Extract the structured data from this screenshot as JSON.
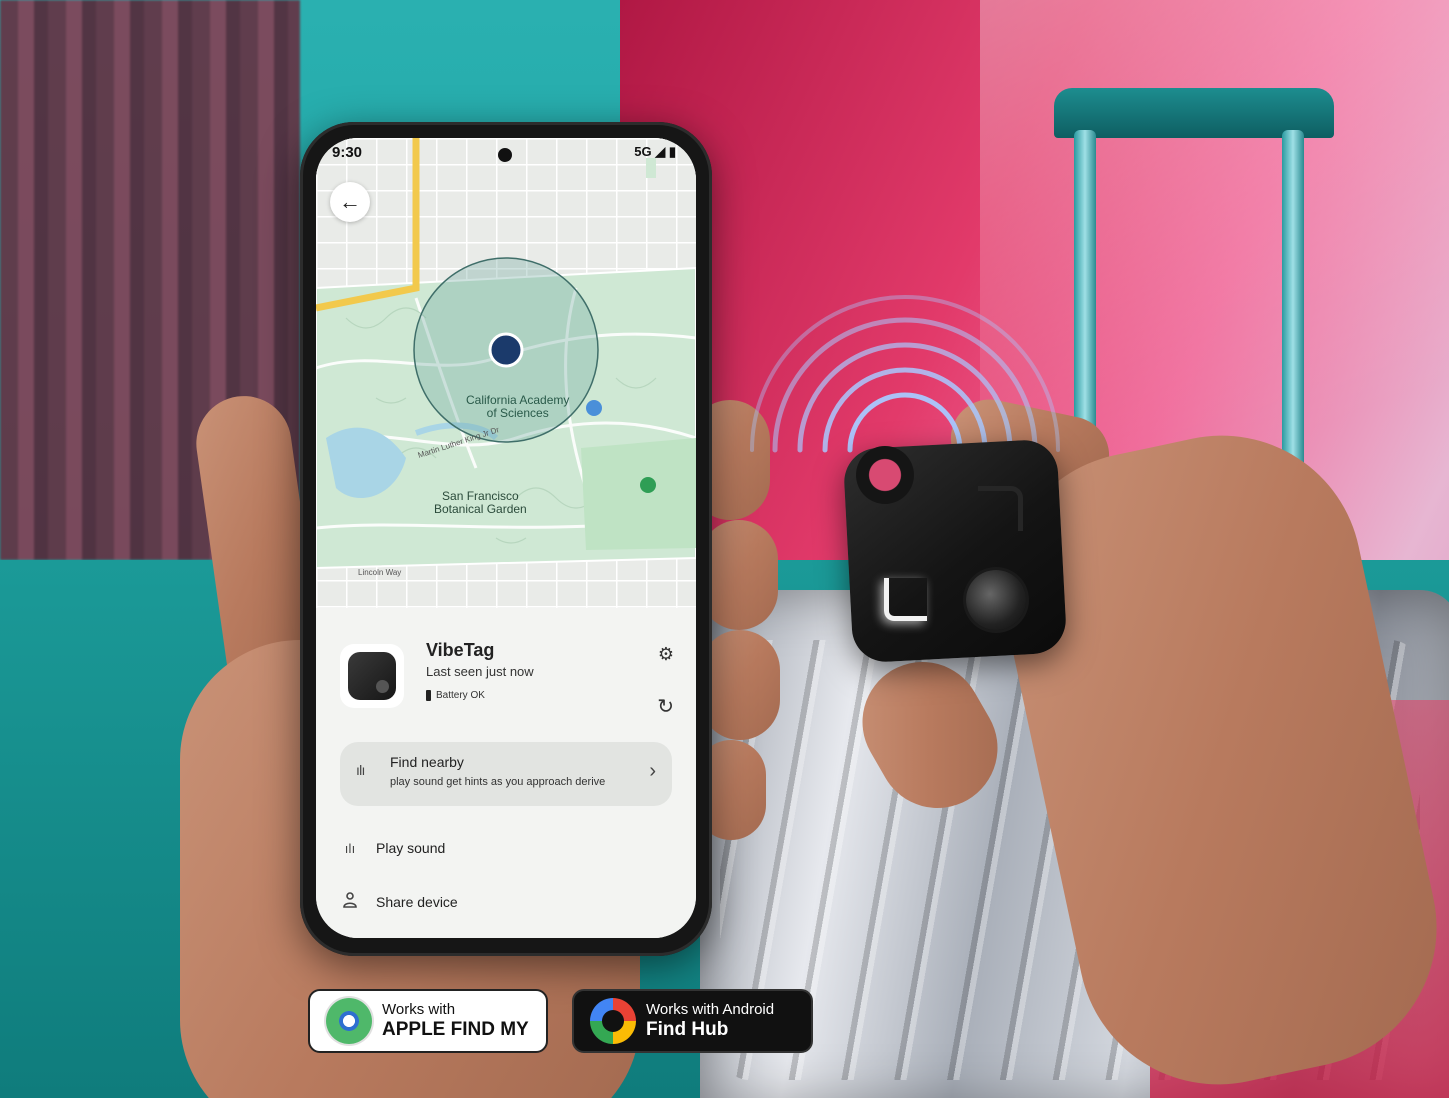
{
  "phone": {
    "status": {
      "time": "9:30",
      "network": "5G"
    },
    "map": {
      "labels": {
        "academy_line1": "California Academy",
        "academy_line2": "of Sciences",
        "garden_line1": "San Francisco",
        "garden_line2": "Botanical Garden",
        "street": "Martin Luther King Jr Dr",
        "way": "Lincoln Way"
      }
    },
    "device": {
      "name": "VibeTag",
      "last_seen": "Last seen just now",
      "battery": "Battery OK"
    },
    "find_nearby": {
      "title": "Find nearby",
      "subtitle": "play sound get hints as you approach derive"
    },
    "actions": [
      {
        "label": "Play sound",
        "icon": "sound-wave-icon"
      },
      {
        "label": "Share device",
        "icon": "person-icon"
      }
    ]
  },
  "badges": {
    "apple": {
      "small": "Works with",
      "big": "APPLE FIND MY"
    },
    "android": {
      "small": "Works with Android",
      "big": "Find Hub"
    }
  },
  "colors": {
    "map_park": "#cfe8d4",
    "map_road_yellow": "#f2c94c",
    "location_dot": "#1b3a6b",
    "badge_dark": "#111111"
  }
}
